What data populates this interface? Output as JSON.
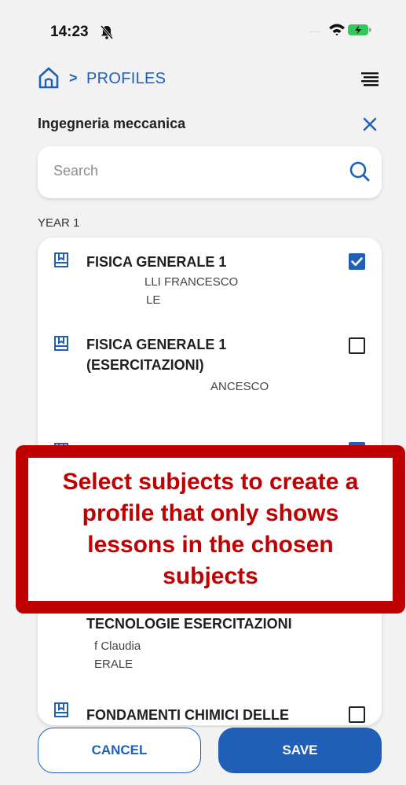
{
  "status_bar": {
    "time": "14:23",
    "signal": "....",
    "icons": [
      "bell-slash-icon",
      "wifi-icon",
      "battery-charging-icon"
    ]
  },
  "nav": {
    "home_icon": "home-icon",
    "separator": ">",
    "breadcrumb": "PROFILES",
    "menu_icon": "menu-icon"
  },
  "header": {
    "course_title": "Ingegneria meccanica",
    "close_icon": "close-icon"
  },
  "search": {
    "placeholder": "Search",
    "value": ""
  },
  "year_label": "YEAR 1",
  "subjects": [
    {
      "name": "FISICA GENERALE 1",
      "teacher": "LLI FRANCESCO",
      "meta2": "LE",
      "checked": true
    },
    {
      "name": "FISICA GENERALE 1 (ESERCITAZIONI)",
      "teacher": "ANCESCO",
      "meta2": "",
      "checked": false
    },
    {
      "name": "TECNOLOGIE ESERCITAZIONI",
      "teacher": "f Claudia",
      "meta2": "ERALE",
      "checked": true
    },
    {
      "name": "FONDAMENTI CHIMICI DELLE",
      "teacher": "",
      "meta2": "",
      "checked": false
    }
  ],
  "actions": {
    "cancel_label": "CANCEL",
    "save_label": "SAVE"
  },
  "annotation": {
    "text": "Select subjects to create a profile that only shows lessons in the chosen subjects"
  },
  "colors": {
    "accent": "#1f5fb8",
    "annotation": "#c00000",
    "background": "#f2f2f2"
  }
}
